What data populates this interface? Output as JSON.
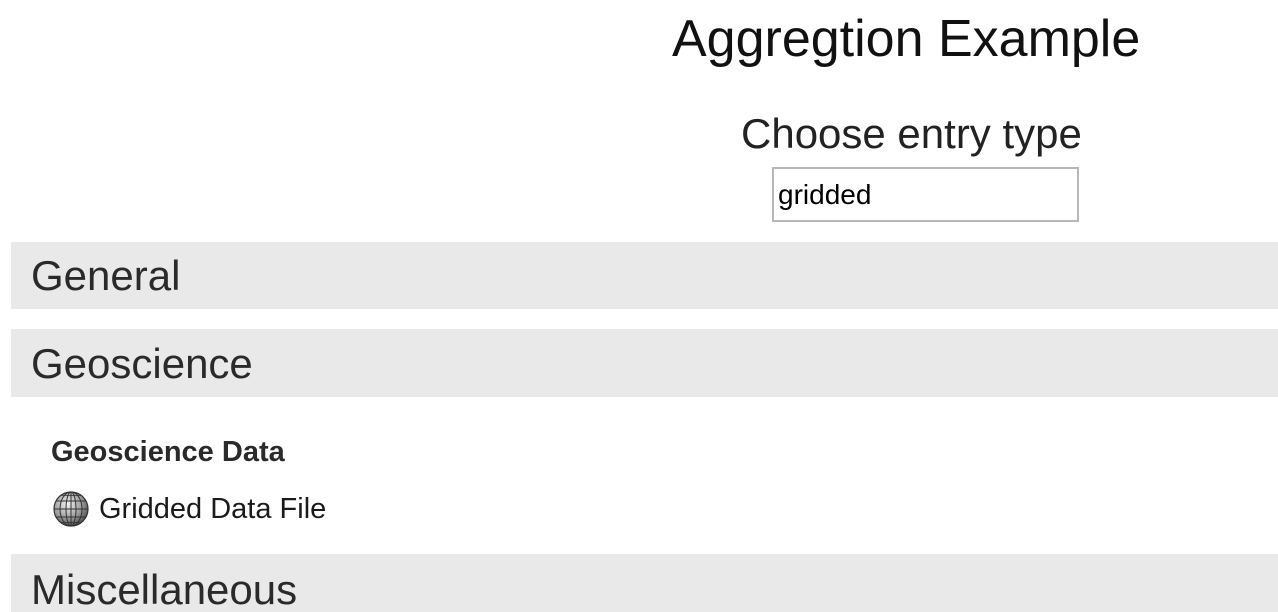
{
  "header": {
    "title": "Aggregtion Example",
    "subtitle": "Choose entry type"
  },
  "search": {
    "value": "gridded",
    "placeholder": ""
  },
  "categories": [
    {
      "label": "General"
    },
    {
      "label": "Geoscience"
    },
    {
      "label": "Miscellaneous"
    }
  ],
  "geoscience": {
    "group_heading": "Geoscience Data",
    "items": [
      {
        "label": "Gridded Data File",
        "icon": "globe-icon"
      }
    ]
  },
  "colors": {
    "category_background": "#e9e9e9",
    "input_border": "#b7b7b7"
  }
}
